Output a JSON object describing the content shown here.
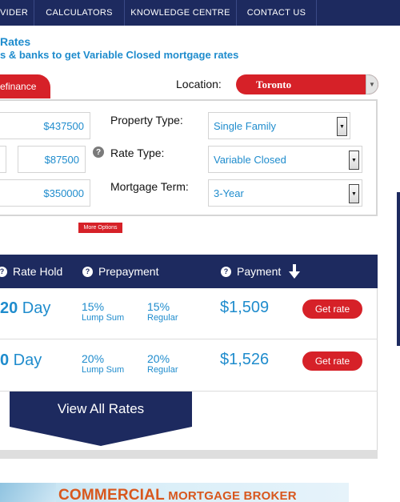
{
  "nav": {
    "items": [
      "VIDER",
      "CALCULATORS",
      "KNOWLEDGE CENTRE",
      "CONTACT US"
    ]
  },
  "heading": {
    "title": "Rates",
    "subtitle": "s & banks to get Variable Closed mortgage rates"
  },
  "tabs": {
    "active": "efinance"
  },
  "location": {
    "label": "Location:",
    "value": "Toronto"
  },
  "form": {
    "amounts": [
      "$437500",
      "$87500",
      "$350000"
    ],
    "property_type": {
      "label": "Property Type:",
      "value": "Single Family"
    },
    "rate_type": {
      "label": "Rate Type:",
      "value": "Variable Closed"
    },
    "mortgage_term": {
      "label": "Mortgage Term:",
      "value": "3-Year"
    },
    "more_options": "More Options"
  },
  "results": {
    "headers": {
      "rate_hold": "Rate Hold",
      "prepayment": "Prepayment",
      "payment": "Payment"
    },
    "rows": [
      {
        "hold_num": "20",
        "hold_unit": " Day",
        "lump_pct": "15%",
        "lump_label": "Lump Sum",
        "regular_pct": "15%",
        "regular_label": "Regular",
        "payment": "$1,509",
        "button": "Get rate"
      },
      {
        "hold_num": "0",
        "hold_unit": " Day",
        "lump_pct": "20%",
        "lump_label": "Lump Sum",
        "regular_pct": "20%",
        "regular_label": "Regular",
        "payment": "$1,526",
        "button": "Get rate"
      }
    ],
    "view_all": "View All Rates"
  },
  "ad": {
    "big": "COMMERCIAL",
    "rest": " MORTGAGE BROKER"
  },
  "colors": {
    "navy": "#1d2a5f",
    "red": "#d62128",
    "blue_text": "#1f8ccd"
  }
}
